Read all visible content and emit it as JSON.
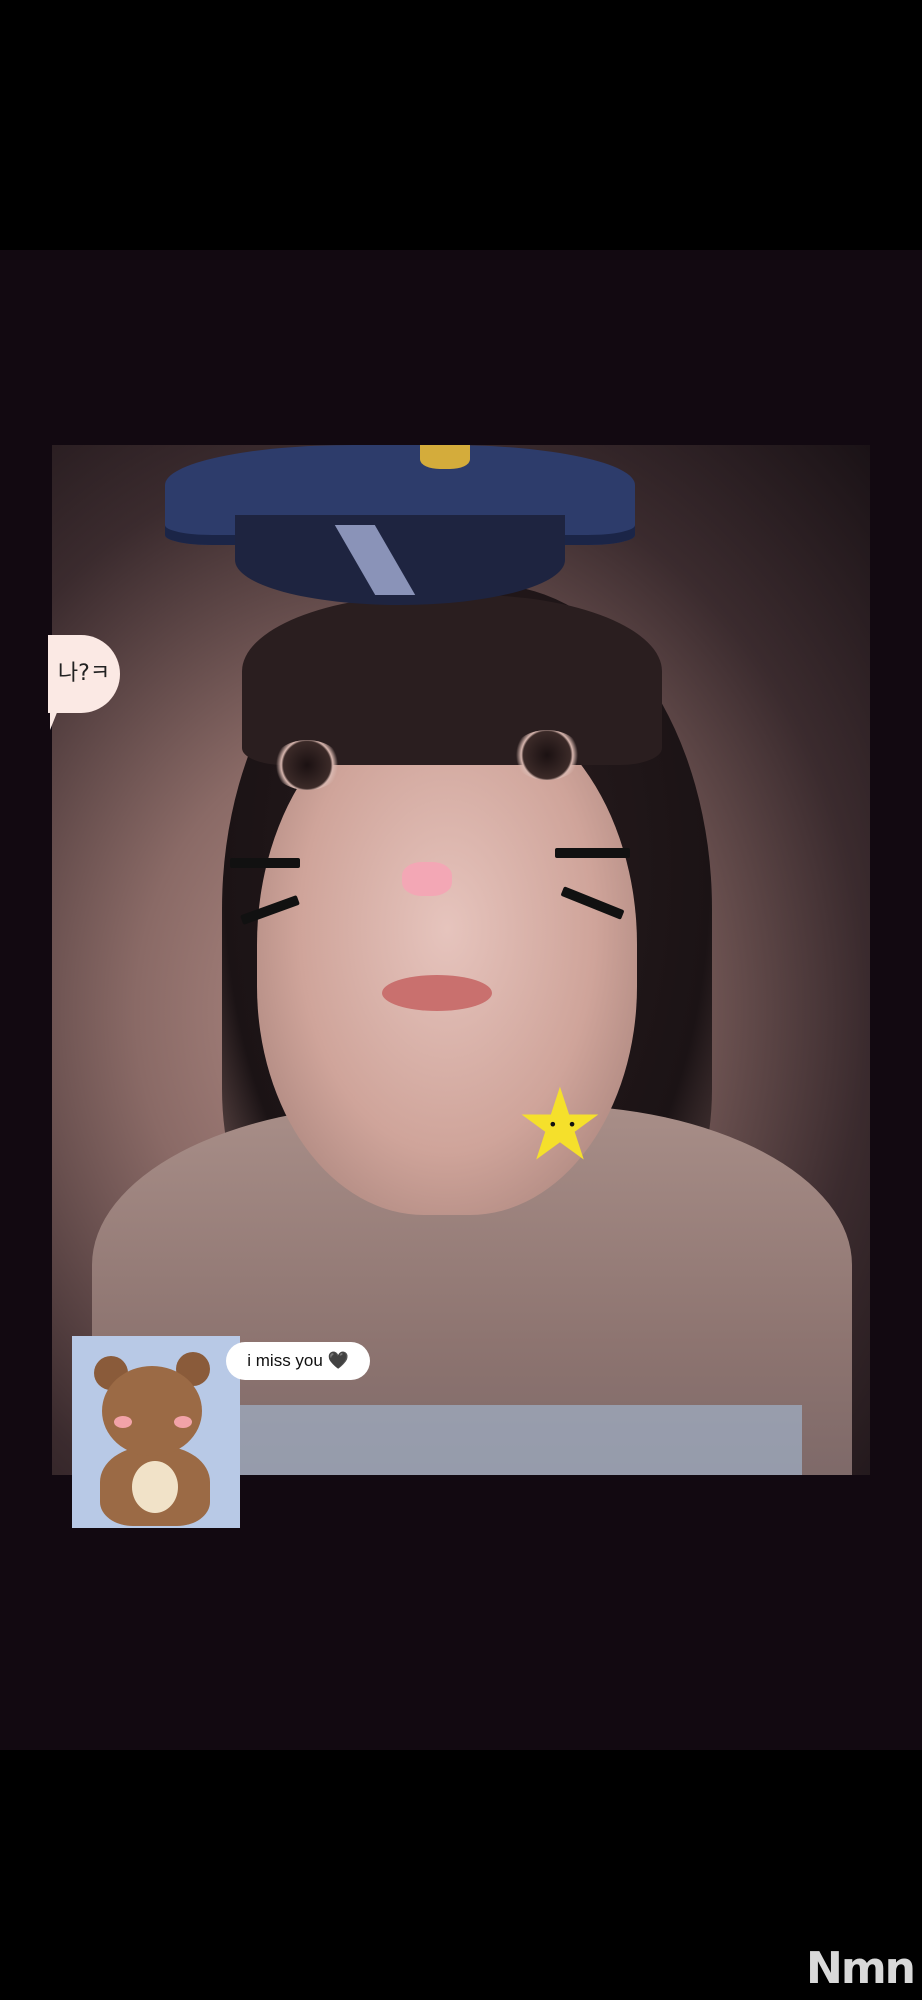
{
  "colors": {
    "background": "#000000",
    "card": "#120911",
    "chat_bubble": "#ffffff",
    "star": "#f5e02b",
    "nose": "#f3a7b5"
  },
  "photo": {
    "sticker_speech_text": "나?ㅋ",
    "sticker_chat_text": "i miss you 🖤",
    "star_icon": "star-icon",
    "bear_icon": "bear-icon"
  },
  "watermark": {
    "text": "Nmn"
  }
}
